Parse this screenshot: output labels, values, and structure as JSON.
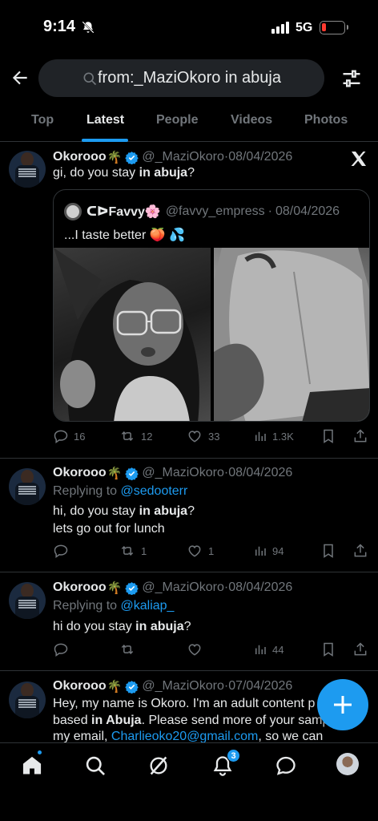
{
  "status_bar": {
    "time": "9:14",
    "network": "5G",
    "icons": [
      "bell-slash-icon",
      "signal-icon",
      "battery-low-icon"
    ]
  },
  "search": {
    "query": "from:_MaziOkoro in abuja",
    "icons": [
      "back-arrow-icon",
      "search-icon",
      "filter-sliders-icon"
    ]
  },
  "tabs": [
    {
      "label": "Top",
      "active": false
    },
    {
      "label": "Latest",
      "active": true
    },
    {
      "label": "People",
      "active": false
    },
    {
      "label": "Videos",
      "active": false
    },
    {
      "label": "Photos",
      "active": false
    }
  ],
  "tweets": [
    {
      "name": "Okorooo",
      "emoji": "🌴",
      "handle": "@_MaziOkoro",
      "dot": "·",
      "date": "08/04/2026",
      "text_before": "gi, do you stay ",
      "text_bold": "in abuja",
      "text_after": "?",
      "quote": {
        "name": "ᑕᐅFavvy🌸",
        "handle": "@favvy_empress",
        "dot": "·",
        "date": "08/04/2026",
        "text": "...I taste better 🍑 💦"
      },
      "stats": {
        "replies": "16",
        "reposts": "12",
        "likes": "33",
        "views": "1.3K"
      }
    },
    {
      "name": "Okorooo",
      "emoji": "🌴",
      "handle": "@_MaziOkoro",
      "dot": "·",
      "date": "08/04/2026",
      "replying_prefix": "Replying to ",
      "replying_to": "@sedooterr",
      "line1_before": "hi, do you stay ",
      "line1_bold": "in abuja",
      "line1_after": "?",
      "line2": "lets go out for lunch",
      "stats": {
        "replies": "",
        "reposts": "1",
        "likes": "1",
        "views": "94"
      }
    },
    {
      "name": "Okorooo",
      "emoji": "🌴",
      "handle": "@_MaziOkoro",
      "dot": "·",
      "date": "08/04/2026",
      "replying_prefix": "Replying to ",
      "replying_to": "@kaliap_",
      "line1_before": "hi do you stay ",
      "line1_bold": "in abuja",
      "line1_after": "?",
      "stats": {
        "replies": "",
        "reposts": "",
        "likes": "",
        "views": "44"
      }
    },
    {
      "name": "Okorooo",
      "emoji": "🌴",
      "handle": "@_MaziOkoro",
      "dot": "·",
      "date": "07/04/2026",
      "line1": "Hey, my name is Okoro. I'm an adult content p",
      "line2_before": "based ",
      "line2_bold": "in Abuja",
      "line2_after": ". Please send more  of your samp",
      "line3_before": "my email, ",
      "line3_link": "Charlieoko20@gmail.com",
      "line3_after": ", so we can"
    }
  ],
  "bottom_nav": {
    "items": [
      "home-icon",
      "search-icon",
      "grok-icon",
      "notifications-icon",
      "messages-icon",
      "profile-avatar"
    ],
    "notification_count": "3"
  },
  "colors": {
    "background": "#000000",
    "accent": "#1d9bf0",
    "text_primary": "#e7e9ea",
    "text_secondary": "#71767b",
    "divider": "#2f3336"
  }
}
